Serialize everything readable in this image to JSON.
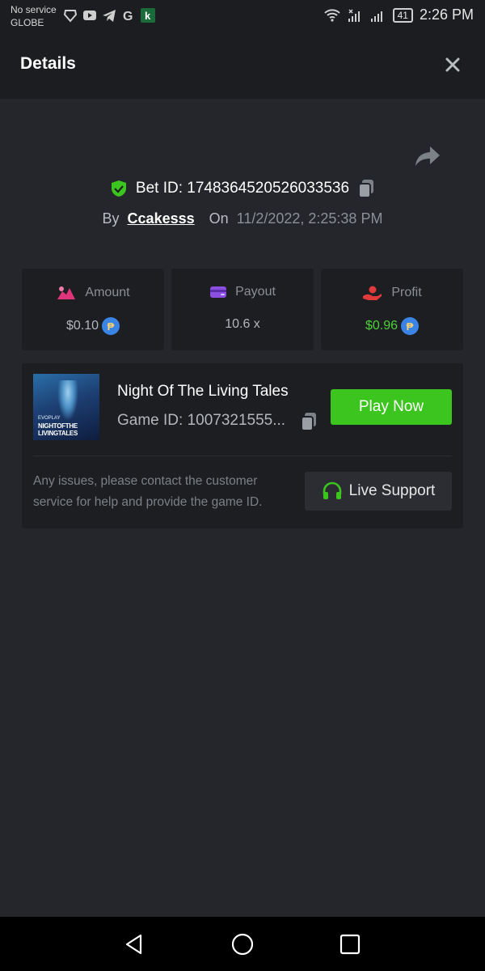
{
  "status_bar": {
    "carrier_line1": "No service",
    "carrier_line2": "GLOBE",
    "battery": "41",
    "time": "2:26 PM"
  },
  "header": {
    "title": "Details"
  },
  "bet": {
    "id_text": "Bet ID: 1748364520526033536",
    "by_label": "By",
    "username": "Ccakesss",
    "on_label": "On",
    "date": "11/2/2022, 2:25:38 PM"
  },
  "stats": {
    "amount": {
      "label": "Amount",
      "value": "$0.10",
      "coin": "₱"
    },
    "payout": {
      "label": "Payout",
      "value": "10.6 x"
    },
    "profit": {
      "label": "Profit",
      "value": "$0.96",
      "coin": "₱"
    }
  },
  "game": {
    "title": "Night Of The Living Tales",
    "game_id": "Game ID: 1007321555...",
    "play_label": "Play Now",
    "thumb_brand": "EVOPLAY",
    "thumb_title_1": "NIGHTOFTHE",
    "thumb_title_2": "LIVINGTALES"
  },
  "support": {
    "help_text": "Any issues, please contact the customer service for help and provide the game ID.",
    "live_label": "Live Support"
  },
  "colors": {
    "accent_green": "#3cc51e",
    "profit_green": "#4cd137",
    "background": "#24262b",
    "card": "#1d1e22"
  }
}
